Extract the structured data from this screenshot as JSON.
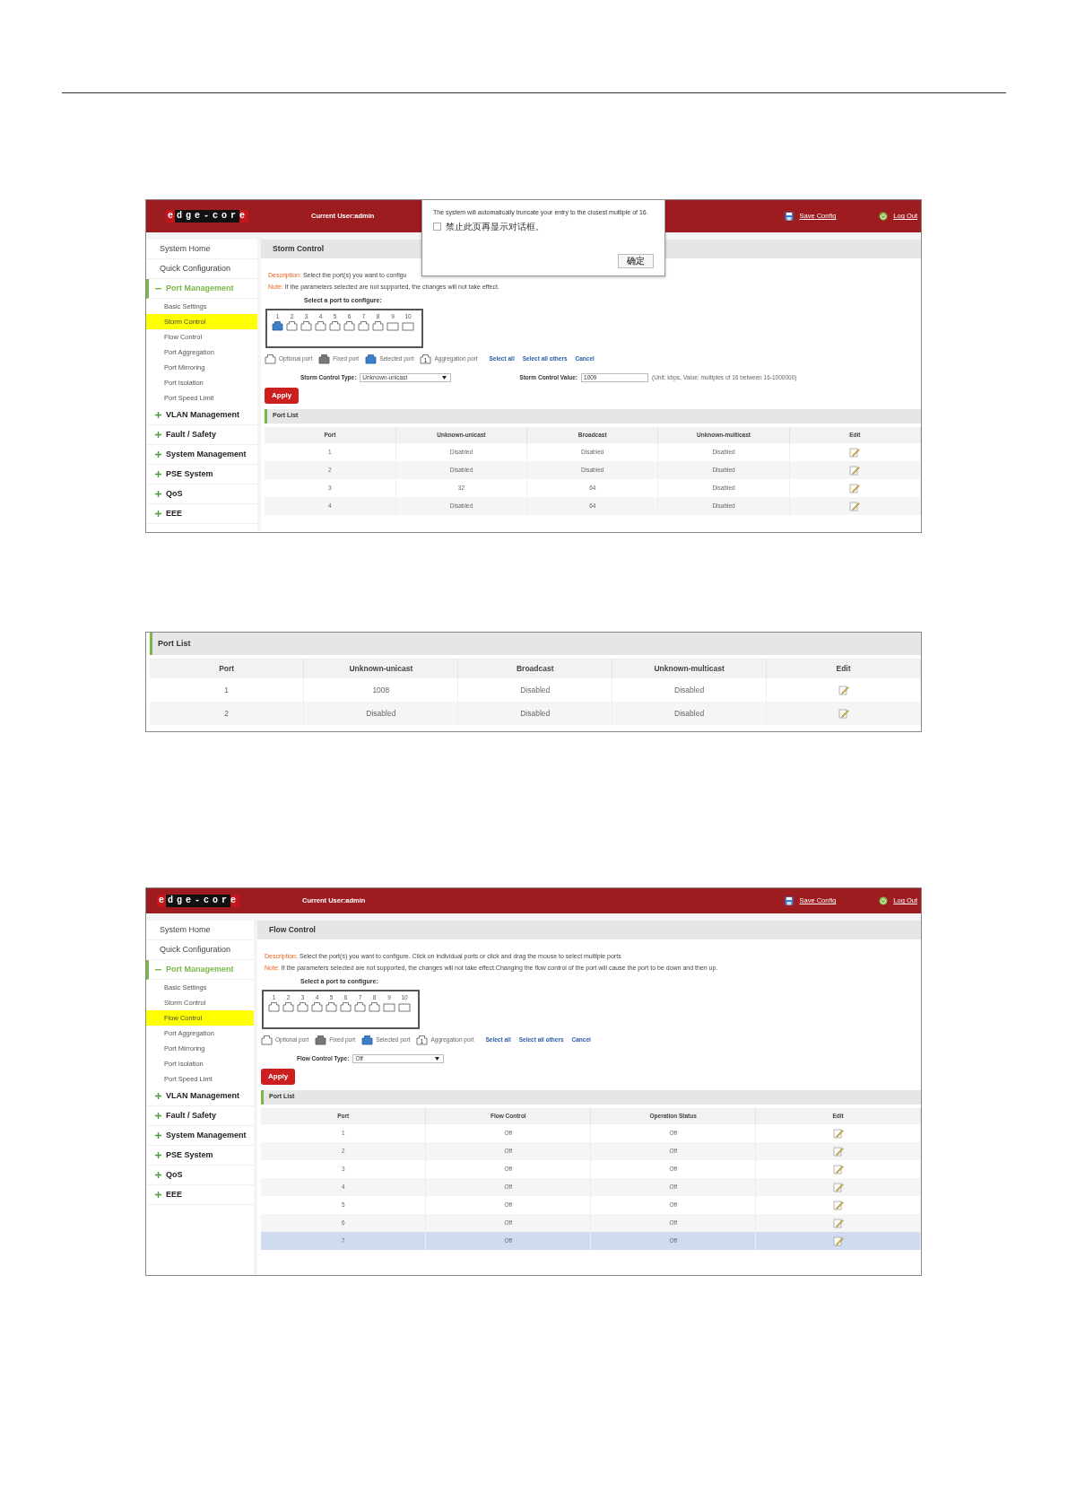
{
  "screens": [
    {
      "kind": "admin",
      "header": {
        "logo": "edge-core",
        "user": "Current User:admin",
        "save": "Save Config",
        "logout": "Log Out"
      },
      "sidebar": [
        {
          "kind": "link",
          "label": "System Home"
        },
        {
          "kind": "link",
          "label": "Quick Configuration"
        },
        {
          "kind": "group",
          "label": "Port Management",
          "expanded": true,
          "children": [
            {
              "label": "Basic Settings",
              "selected": false
            },
            {
              "label": "Storm Control",
              "selected": true
            },
            {
              "label": "Flow Control",
              "selected": false
            },
            {
              "label": "Port Aggregation",
              "selected": false
            },
            {
              "label": "Port Mirroring",
              "selected": false
            },
            {
              "label": "Port Isolation",
              "selected": false
            },
            {
              "label": "Port Speed Limit",
              "selected": false
            }
          ]
        },
        {
          "kind": "group",
          "label": "VLAN Management",
          "expanded": false
        },
        {
          "kind": "group",
          "label": "Fault / Safety",
          "expanded": false
        },
        {
          "kind": "group",
          "label": "System Management",
          "expanded": false
        },
        {
          "kind": "group",
          "label": "PSE System",
          "expanded": false
        },
        {
          "kind": "group",
          "label": "QoS",
          "expanded": false
        },
        {
          "kind": "group",
          "label": "EEE",
          "expanded": false
        }
      ],
      "title": "Storm Control",
      "notes": [
        {
          "label": "Description:",
          "text": "Select the port(s) you want to configu"
        },
        {
          "label": "Note:",
          "text": "If the parameters selected are not supported, the changes will not take effect."
        }
      ],
      "port_picker": {
        "label": "Select a port to configure:",
        "ports": [
          {
            "number": "1",
            "kind": "rj45",
            "selected": true
          },
          {
            "number": "2",
            "kind": "rj45",
            "selected": false
          },
          {
            "number": "3",
            "kind": "rj45",
            "selected": false
          },
          {
            "number": "4",
            "kind": "rj45",
            "selected": false
          },
          {
            "number": "5",
            "kind": "rj45",
            "selected": false
          },
          {
            "number": "6",
            "kind": "rj45",
            "selected": false
          },
          {
            "number": "7",
            "kind": "rj45",
            "selected": false
          },
          {
            "number": "8",
            "kind": "rj45",
            "selected": false
          },
          {
            "number": "9",
            "kind": "sfp",
            "selected": false
          },
          {
            "number": "10",
            "kind": "sfp",
            "selected": false
          }
        ]
      },
      "legend": [
        {
          "kind": "optional",
          "label": "Optional port"
        },
        {
          "kind": "fixed",
          "label": "Fixed port"
        },
        {
          "kind": "selected",
          "label": "Selected port"
        },
        {
          "kind": "aggregation",
          "badge": "1",
          "label": "Aggregation port"
        }
      ],
      "links": [
        "Select all",
        "Select all others",
        "Cancel"
      ],
      "fields": [
        {
          "kind": "select",
          "label": "Storm Control Type:",
          "value": "Unknown-unicast"
        },
        {
          "kind": "input",
          "label": "Storm Control Value:",
          "value": "1009",
          "hint": "(Unit: kbps, Value: multiples of 16 between 16-1000000)"
        }
      ],
      "apply": "Apply",
      "port_list": {
        "title": "Port List",
        "columns": [
          "Port",
          "Unknown-unicast",
          "Broadcast",
          "Unknown-multicast",
          "Edit"
        ],
        "rows": [
          {
            "cells": [
              "1",
              "Disabled",
              "Disabled",
              "Disabled"
            ],
            "selected": false
          },
          {
            "cells": [
              "2",
              "Disabled",
              "Disabled",
              "Disabled"
            ],
            "selected": false
          },
          {
            "cells": [
              "3",
              "32",
              "64",
              "Disabled"
            ],
            "selected": false
          },
          {
            "cells": [
              "4",
              "Disabled",
              "64",
              "Disabled"
            ],
            "selected": false
          }
        ]
      },
      "dialog": {
        "text": "The system will automatically truncate your entry to the closest multiple of 16.",
        "checkbox": {
          "label": "禁止此页再显示对话框。",
          "checked": false
        },
        "button": "确定"
      }
    },
    {
      "kind": "panel",
      "port_list": {
        "title": "Port List",
        "columns": [
          "Port",
          "Unknown-unicast",
          "Broadcast",
          "Unknown-multicast",
          "Edit"
        ],
        "rows": [
          {
            "cells": [
              "1",
              "1008",
              "Disabled",
              "Disabled"
            ],
            "selected": false
          },
          {
            "cells": [
              "2",
              "Disabled",
              "Disabled",
              "Disabled"
            ],
            "selected": false
          }
        ]
      }
    },
    {
      "kind": "admin",
      "header": {
        "logo": "edge-core",
        "user": "Current User:admin",
        "save": "Save Config",
        "logout": "Log Out"
      },
      "sidebar": [
        {
          "kind": "link",
          "label": "System Home"
        },
        {
          "kind": "link",
          "label": "Quick Configuration"
        },
        {
          "kind": "group",
          "label": "Port Management",
          "expanded": true,
          "children": [
            {
              "label": "Basic Settings",
              "selected": false
            },
            {
              "label": "Storm Control",
              "selected": false
            },
            {
              "label": "Flow Control",
              "selected": true
            },
            {
              "label": "Port Aggregation",
              "selected": false
            },
            {
              "label": "Port Mirroring",
              "selected": false
            },
            {
              "label": "Port Isolation",
              "selected": false
            },
            {
              "label": "Port Speed Limt",
              "selected": false
            }
          ]
        },
        {
          "kind": "group",
          "label": "VLAN Management",
          "expanded": false
        },
        {
          "kind": "group",
          "label": "Fault / Safety",
          "expanded": false
        },
        {
          "kind": "group",
          "label": "System Management",
          "expanded": false
        },
        {
          "kind": "group",
          "label": "PSE System",
          "expanded": false
        },
        {
          "kind": "group",
          "label": "QoS",
          "expanded": false
        },
        {
          "kind": "group",
          "label": "EEE",
          "expanded": false
        }
      ],
      "title": "Flow Control",
      "notes": [
        {
          "label": "Description:",
          "text": "Select the port(s) you want to configure. Click on individual ports or click and drag the mouse to select multiple ports"
        },
        {
          "label": "Note:",
          "text": "If the parameters selected are not supported, the changes will not take effect.Changing the flow control of the port will cause the port to be down and then up."
        }
      ],
      "port_picker": {
        "label": "Select a port to configure:",
        "ports": [
          {
            "number": "1",
            "kind": "rj45",
            "selected": false
          },
          {
            "number": "2",
            "kind": "rj45",
            "selected": false
          },
          {
            "number": "3",
            "kind": "rj45",
            "selected": false
          },
          {
            "number": "4",
            "kind": "rj45",
            "selected": false
          },
          {
            "number": "5",
            "kind": "rj45",
            "selected": false
          },
          {
            "number": "6",
            "kind": "rj45",
            "selected": false
          },
          {
            "number": "7",
            "kind": "rj45",
            "selected": false
          },
          {
            "number": "8",
            "kind": "rj45",
            "selected": false
          },
          {
            "number": "9",
            "kind": "sfp",
            "selected": false
          },
          {
            "number": "10",
            "kind": "sfp",
            "selected": false
          }
        ]
      },
      "legend": [
        {
          "kind": "optional",
          "label": "Optional port"
        },
        {
          "kind": "fixed",
          "label": "Fixed port"
        },
        {
          "kind": "selected",
          "label": "Selected port"
        },
        {
          "kind": "aggregation",
          "badge": "1",
          "label": "Aggregation port"
        }
      ],
      "links": [
        "Select all",
        "Select all others",
        "Cancel"
      ],
      "fields": [
        {
          "kind": "select",
          "label": "Flow Control Type:",
          "value": "Off"
        }
      ],
      "apply": "Apply",
      "port_list": {
        "title": "Port List",
        "columns": [
          "Port",
          "Flow Control",
          "Operation Status",
          "Edit"
        ],
        "rows": [
          {
            "cells": [
              "1",
              "Off",
              "Off"
            ],
            "selected": false
          },
          {
            "cells": [
              "2",
              "Off",
              "Off"
            ],
            "selected": false
          },
          {
            "cells": [
              "3",
              "Off",
              "Off"
            ],
            "selected": false
          },
          {
            "cells": [
              "4",
              "Off",
              "Off"
            ],
            "selected": false
          },
          {
            "cells": [
              "5",
              "Off",
              "Off"
            ],
            "selected": false
          },
          {
            "cells": [
              "6",
              "Off",
              "Off"
            ],
            "selected": false
          },
          {
            "cells": [
              "7",
              "Off",
              "Off"
            ],
            "selected": true
          }
        ]
      }
    }
  ]
}
